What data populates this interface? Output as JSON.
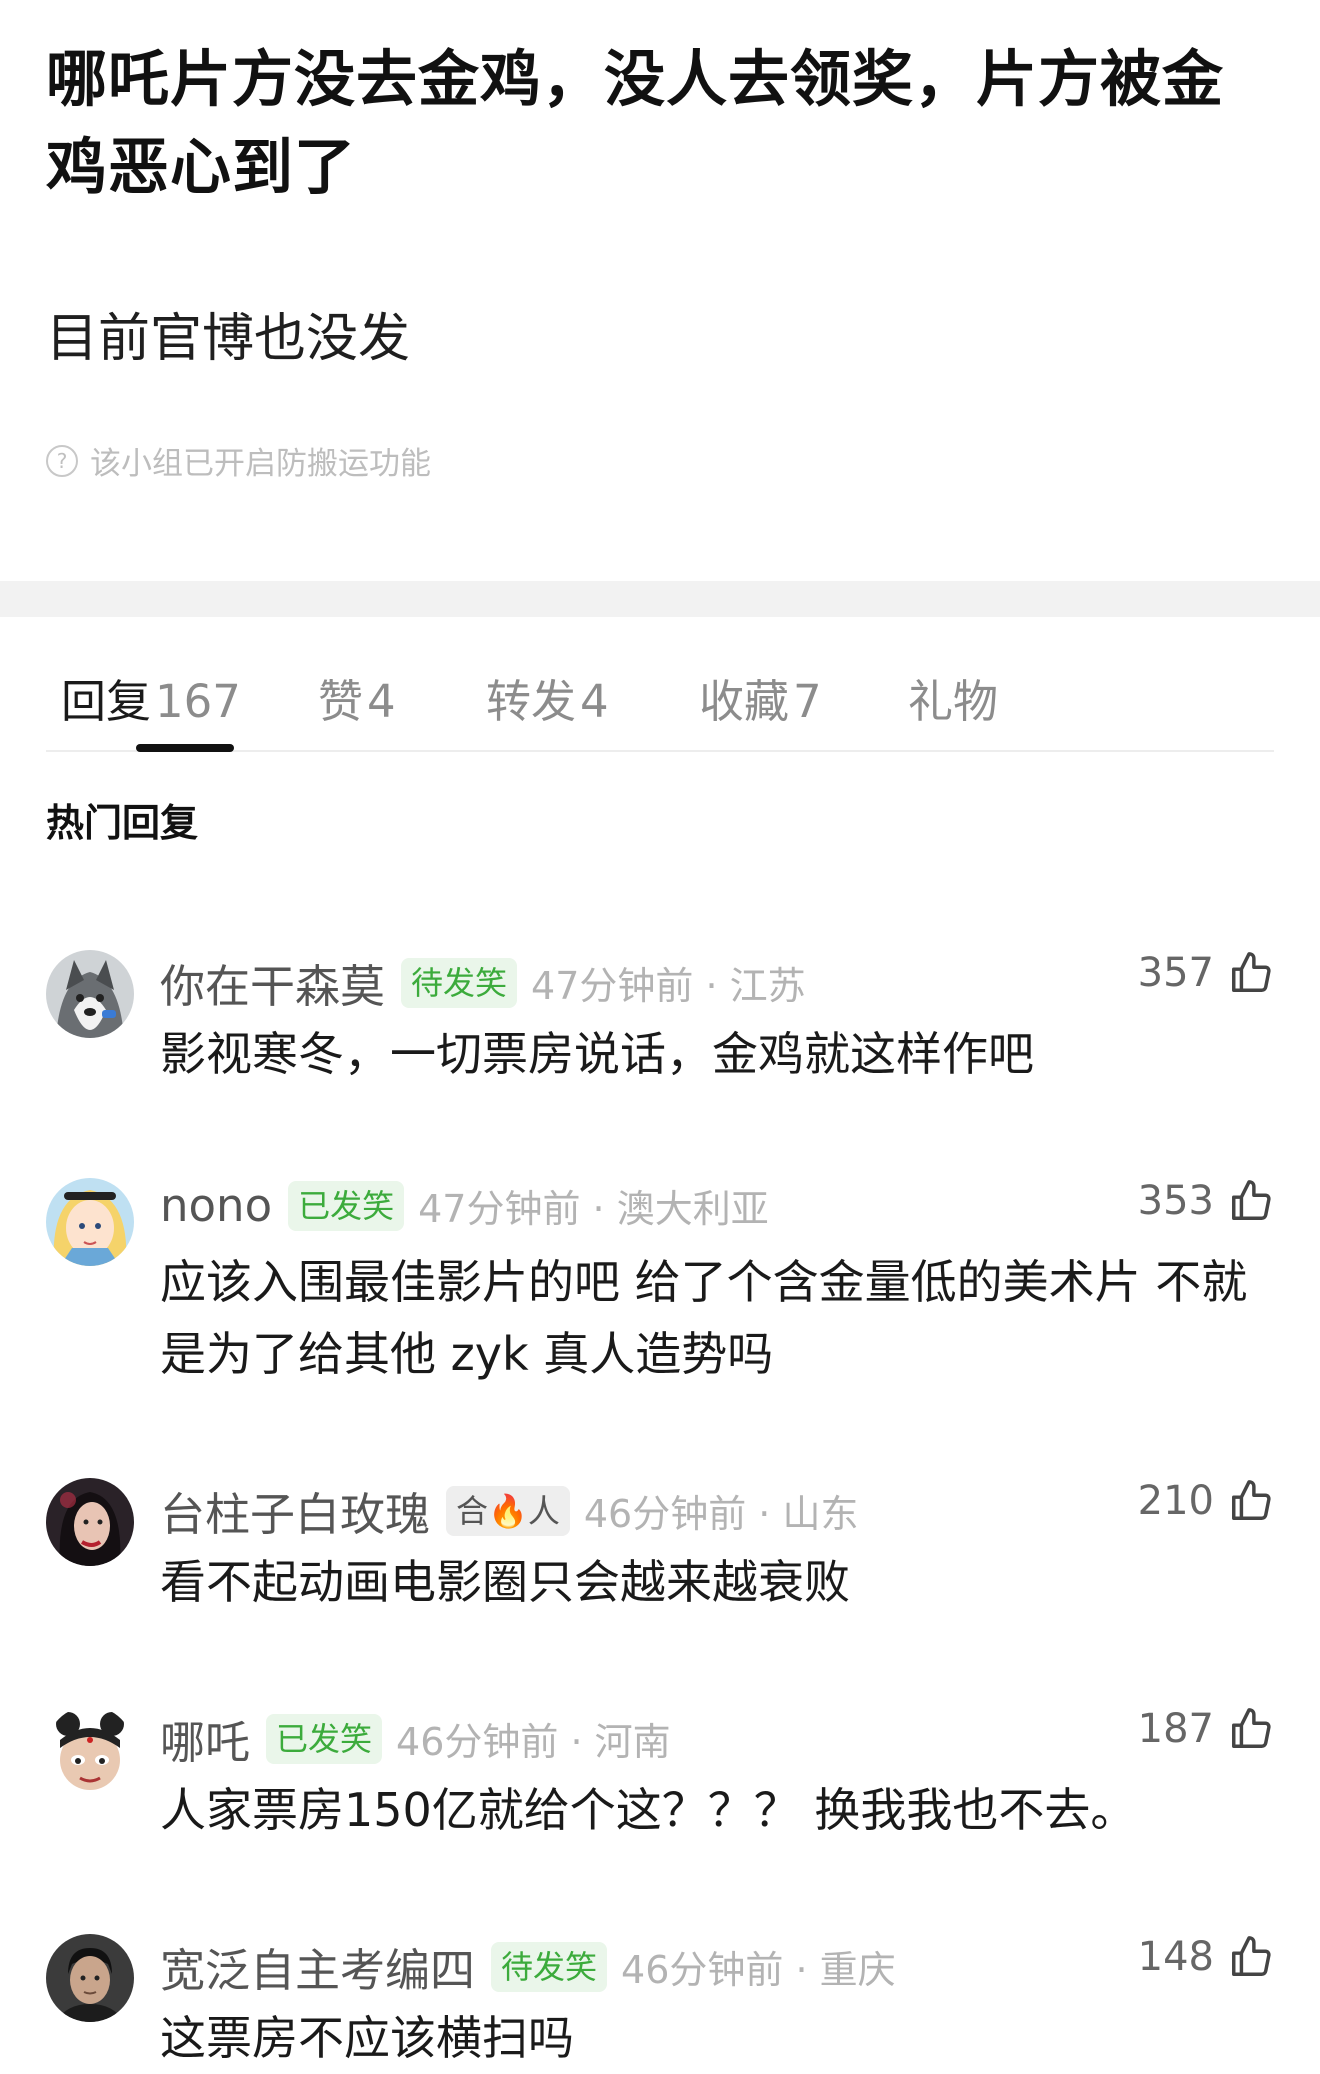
{
  "post": {
    "title": "哪吒片方没去金鸡，没人去领奖，片方被金鸡恶心到了",
    "body": "目前官博也没发",
    "notice": "该小组已开启防搬运功能",
    "notice_icon": "question-circle-icon"
  },
  "tabs": [
    {
      "label": "回复",
      "count": "167"
    },
    {
      "label": "赞",
      "count": "4"
    },
    {
      "label": "转发",
      "count": "4"
    },
    {
      "label": "收藏",
      "count": "7"
    },
    {
      "label": "礼物",
      "count": ""
    }
  ],
  "section_title": "热门回复",
  "comments": [
    {
      "user": "你在干森莫",
      "badge": "待发笑",
      "time": "47分钟前 · 江苏",
      "likes": "357",
      "text": "影视寒冬，一切票房说话，金鸡就这样作吧",
      "avatar": "husky-dog-avatar"
    },
    {
      "user": "nono",
      "badge": "已发笑",
      "time": "47分钟前 · 澳大利亚",
      "likes": "353",
      "text": "应该入围最佳影片的吧 给了个含金量低的美术片 不就是为了给其他 zyk 真人造势吗",
      "avatar": "alice-cartoon-avatar"
    },
    {
      "user": "台柱子白玫瑰",
      "badge": "合🔥人",
      "time": "46分钟前 · 山东",
      "likes": "210",
      "text": "看不起动画电影圈只会越来越衰败",
      "avatar": "woman-portrait-avatar"
    },
    {
      "user": "哪吒",
      "badge": "已发笑",
      "time": "46分钟前 · 河南",
      "likes": "187",
      "text": "人家票房150亿就给个这？？？ 换我我也不去。",
      "avatar": "nezha-cartoon-avatar"
    },
    {
      "user": "宽泛自主考编四",
      "badge": "待发笑",
      "time": "46分钟前 · 重庆",
      "likes": "148",
      "text": "这票房不应该横扫吗",
      "avatar": "man-portrait-avatar"
    }
  ],
  "like_icon": "thumbs-up-icon"
}
